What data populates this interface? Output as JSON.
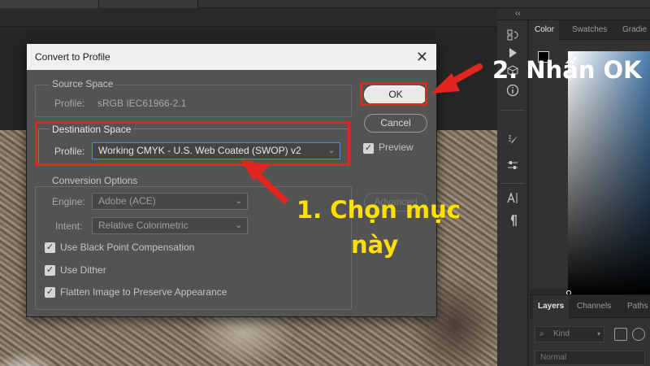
{
  "workspace": {
    "color_panel": {
      "tabs": [
        "Color",
        "Swatches",
        "Gradie"
      ],
      "foreground_color": "#000000"
    },
    "layers_panel": {
      "tabs": [
        "Layers",
        "Channels",
        "Paths"
      ],
      "kind_placeholder": "Kind",
      "blend_mode": "Normal"
    },
    "collapse_glyph": "‹‹"
  },
  "dialog": {
    "title": "Convert to Profile",
    "close_glyph": "✕",
    "source_space": {
      "title": "Source Space",
      "profile_label": "Profile:",
      "profile_value": "sRGB IEC61966-2.1"
    },
    "destination_space": {
      "title": "Destination Space",
      "profile_label": "Profile:",
      "profile_value": "Working CMYK - U.S. Web Coated (SWOP) v2"
    },
    "conversion_options": {
      "title": "Conversion Options",
      "engine_label": "Engine:",
      "engine_value": "Adobe (ACE)",
      "intent_label": "Intent:",
      "intent_value": "Relative Colorimetric",
      "checkboxes": [
        {
          "label": "Use Black Point Compensation",
          "checked": true
        },
        {
          "label": "Use Dither",
          "checked": true
        },
        {
          "label": "Flatten Image to Preserve Appearance",
          "checked": true
        }
      ]
    },
    "buttons": {
      "ok": "OK",
      "cancel": "Cancel",
      "advanced": "Advanced"
    },
    "preview": {
      "label": "Preview",
      "checked": true
    }
  },
  "annotations": {
    "step1_line1": "1. Chọn mục",
    "step1_line2": "này",
    "step2": "2. Nhấn OK",
    "highlight_color": "#e0261f",
    "text_colors": {
      "step1": "#ffe100",
      "step2": "#ffffff"
    }
  }
}
